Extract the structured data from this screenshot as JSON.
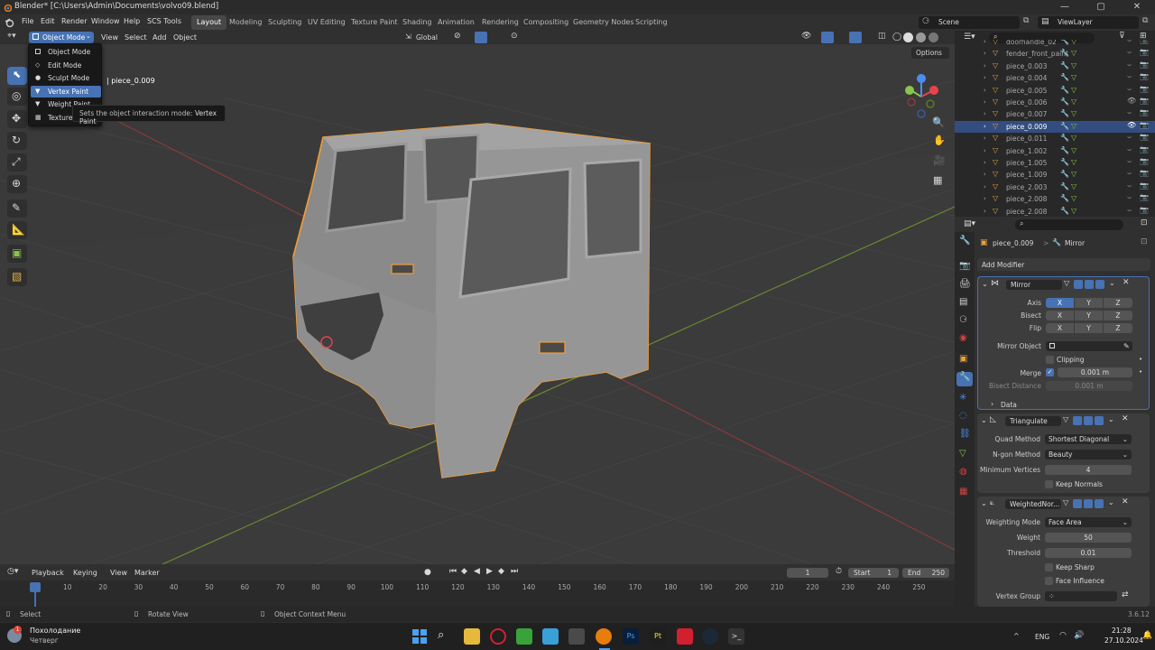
{
  "window": {
    "title": "Blender* [C:\\Users\\Admin\\Documents\\volvo09.blend]",
    "minimize": "—",
    "maximize": "▢",
    "close": "✕"
  },
  "menu": {
    "items": [
      "File",
      "Edit",
      "Render",
      "Window",
      "Help",
      "SCS Tools"
    ]
  },
  "workspaces": [
    "Layout",
    "Modeling",
    "Sculpting",
    "UV Editing",
    "Texture Paint",
    "Shading",
    "Animation",
    "Rendering",
    "Compositing",
    "Geometry Nodes",
    "Scripting"
  ],
  "scene": {
    "name": "Scene",
    "view_layer": "ViewLayer"
  },
  "viewport_header": {
    "mode": "Object Mode",
    "menus": [
      "View",
      "Select",
      "Add",
      "Object"
    ],
    "orientation": "Global",
    "options": "Options"
  },
  "mode_menu": {
    "items": [
      "Object Mode",
      "Edit Mode",
      "Sculpt Mode",
      "Vertex Paint",
      "Weight Paint",
      "Texture"
    ],
    "highlighted": 3
  },
  "tooltip": {
    "text": "Sets the object interaction mode:",
    "value": "Vertex Paint"
  },
  "viewport": {
    "object_label": "| piece_0.009"
  },
  "outliner": {
    "search_placeholder": "",
    "rows": [
      {
        "name": "doorhandle_02",
        "selected": false
      },
      {
        "name": "fender_front_paint",
        "selected": false
      },
      {
        "name": "piece_0.003",
        "selected": false
      },
      {
        "name": "piece_0.004",
        "selected": false
      },
      {
        "name": "piece_0.005",
        "selected": false
      },
      {
        "name": "piece_0.006",
        "selected": false
      },
      {
        "name": "piece_0.007",
        "selected": false
      },
      {
        "name": "piece_0.009",
        "selected": true
      },
      {
        "name": "piece_0.011",
        "selected": false
      },
      {
        "name": "piece_1.002",
        "selected": false
      },
      {
        "name": "piece_1.005",
        "selected": false
      },
      {
        "name": "piece_1.009",
        "selected": false
      },
      {
        "name": "piece_2.003",
        "selected": false
      },
      {
        "name": "piece_2.008",
        "selected": false
      },
      {
        "name": "piece_2.008",
        "selected": false
      }
    ]
  },
  "properties": {
    "breadcrumb_object": "piece_0.009",
    "breadcrumb_sep": ">",
    "breadcrumb_modifier": "Mirror",
    "add_modifier": "Add Modifier",
    "mirror": {
      "name": "Mirror",
      "axis_label": "Axis",
      "bisect_label": "Bisect",
      "flip_label": "Flip",
      "x": "X",
      "y": "Y",
      "z": "Z",
      "mirror_object_label": "Mirror Object",
      "clipping_label": "Clipping",
      "merge_label": "Merge",
      "merge_value": "0.001 m",
      "bisect_distance_label": "Bisect Distance",
      "bisect_distance_value": "0.001 m",
      "data_label": "Data"
    },
    "triangulate": {
      "name": "Triangulate",
      "quad_label": "Quad Method",
      "quad_value": "Shortest Diagonal",
      "ngon_label": "N-gon Method",
      "ngon_value": "Beauty",
      "minv_label": "Minimum Vertices",
      "minv_value": "4",
      "keep_normals_label": "Keep Normals"
    },
    "weighted": {
      "name": "WeightedNor...",
      "mode_label": "Weighting Mode",
      "mode_value": "Face Area",
      "weight_label": "Weight",
      "weight_value": "50",
      "threshold_label": "Threshold",
      "threshold_value": "0.01",
      "keep_sharp_label": "Keep Sharp",
      "face_influence_label": "Face Influence",
      "vertex_group_label": "Vertex Group"
    }
  },
  "timeline": {
    "menus": [
      "Playback",
      "Keying",
      "View",
      "Marker"
    ],
    "current_frame": "1",
    "start_label": "Start",
    "start": "1",
    "end_label": "End",
    "end": "250",
    "ticks": [
      "1",
      "10",
      "20",
      "30",
      "40",
      "50",
      "60",
      "70",
      "80",
      "90",
      "100",
      "110",
      "120",
      "130",
      "140",
      "150",
      "160",
      "170",
      "180",
      "190",
      "200",
      "210",
      "220",
      "230",
      "240",
      "250"
    ]
  },
  "status": {
    "select": "Select",
    "rotate": "Rotate View",
    "context": "Object Context Menu",
    "version": "3.6.12"
  },
  "taskbar": {
    "weather_title": "Похолодание",
    "weather_sub": "Четверг",
    "weather_badge": "1",
    "lang": "ENG",
    "time": "21:28",
    "date": "27.10.2024"
  },
  "colors": {
    "accent": "#4772b3",
    "selection_outline": "#f29d35",
    "x_axis": "#e8434d",
    "y_axis": "#8ac44a",
    "z_axis": "#4b8ef2"
  }
}
